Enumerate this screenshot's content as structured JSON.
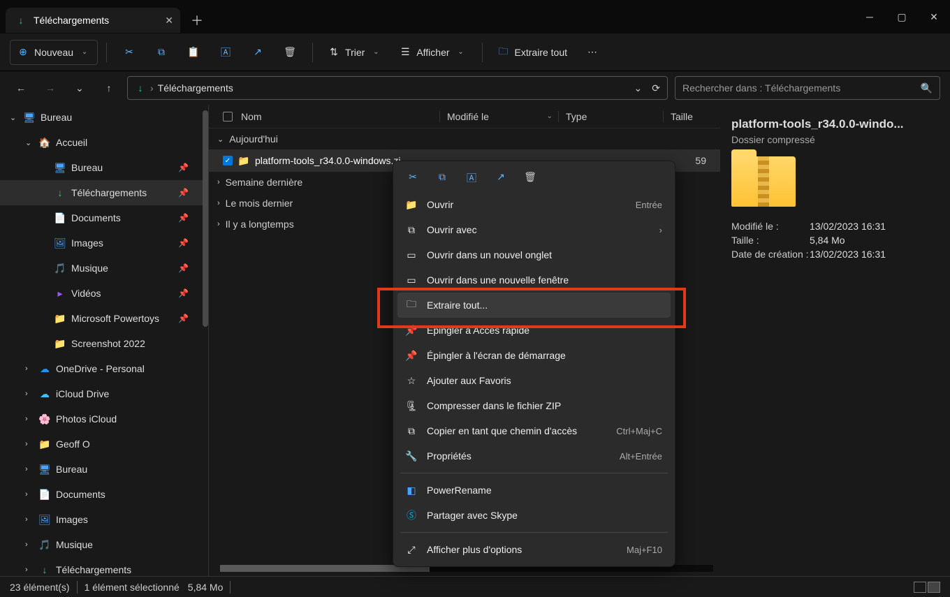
{
  "tab_title": "Téléchargements",
  "toolbar": {
    "new": "Nouveau",
    "sort": "Trier",
    "view": "Afficher",
    "extract": "Extraire tout"
  },
  "breadcrumb": "Téléchargements",
  "search": {
    "placeholder": "Rechercher dans : Téléchargements"
  },
  "sidebar": {
    "items": [
      {
        "label": "Bureau",
        "indent": 0,
        "chev": "⌄",
        "icon": "🖥",
        "color": "#4aa3ff"
      },
      {
        "label": "Accueil",
        "indent": 1,
        "chev": "⌄",
        "icon": "🏠",
        "color": "#ff9a3c"
      },
      {
        "label": "Bureau",
        "indent": 2,
        "icon": "🖥",
        "color": "#4aa3ff",
        "pin": true
      },
      {
        "label": "Téléchargements",
        "indent": 2,
        "icon": "↓",
        "color": "#39c26d",
        "pin": true,
        "sel": true
      },
      {
        "label": "Documents",
        "indent": 2,
        "icon": "📄",
        "color": "#8aa8c9",
        "pin": true
      },
      {
        "label": "Images",
        "indent": 2,
        "icon": "🖼",
        "color": "#4aa3ff",
        "pin": true
      },
      {
        "label": "Musique",
        "indent": 2,
        "icon": "🎵",
        "color": "#ff5e7a",
        "pin": true
      },
      {
        "label": "Vidéos",
        "indent": 2,
        "icon": "▸",
        "color": "#9b59ff",
        "pin": true
      },
      {
        "label": "Microsoft Powertoys",
        "indent": 2,
        "icon": "📁",
        "color": "#ffcf4a",
        "pin": true
      },
      {
        "label": "Screenshot 2022",
        "indent": 2,
        "icon": "📁",
        "color": "#ffcf4a"
      },
      {
        "label": "OneDrive - Personal",
        "indent": 1,
        "chev": "›",
        "icon": "☁",
        "color": "#2a8fe6"
      },
      {
        "label": "iCloud Drive",
        "indent": 1,
        "chev": "›",
        "icon": "☁",
        "color": "#3fc1ff"
      },
      {
        "label": "Photos iCloud",
        "indent": 1,
        "chev": "›",
        "icon": "🌸",
        "color": "#ff7ab3"
      },
      {
        "label": "Geoff O",
        "indent": 1,
        "chev": "›",
        "icon": "📁",
        "color": "#ffcf4a"
      },
      {
        "label": "Bureau",
        "indent": 1,
        "chev": "›",
        "icon": "🖥",
        "color": "#4aa3ff"
      },
      {
        "label": "Documents",
        "indent": 1,
        "chev": "›",
        "icon": "📄",
        "color": "#8aa8c9"
      },
      {
        "label": "Images",
        "indent": 1,
        "chev": "›",
        "icon": "🖼",
        "color": "#4aa3ff"
      },
      {
        "label": "Musique",
        "indent": 1,
        "chev": "›",
        "icon": "🎵",
        "color": "#ff5e7a"
      },
      {
        "label": "Téléchargements",
        "indent": 1,
        "chev": "›",
        "icon": "↓",
        "color": "#39c26d"
      }
    ]
  },
  "columns": {
    "name": "Nom",
    "modified": "Modifié le",
    "type": "Type",
    "size": "Taille"
  },
  "groups": [
    "Aujourd'hui",
    "Semaine dernière",
    "Le mois dernier",
    "Il y a longtemps"
  ],
  "file": {
    "name": "platform-tools_r34.0.0-windows.zi…",
    "size_col": "59"
  },
  "ctx": {
    "open": "Ouvrir",
    "open_sc": "Entrée",
    "openwith": "Ouvrir avec",
    "newtab": "Ouvrir dans un nouvel onglet",
    "newwin": "Ouvrir dans une nouvelle fenêtre",
    "extract": "Extraire tout...",
    "pinquick": "Épingler à Accès rapide",
    "pinstart": "Épingler à l'écran de démarrage",
    "fav": "Ajouter aux Favoris",
    "zip": "Compresser dans le fichier ZIP",
    "copypath": "Copier en tant que chemin d'accès",
    "copypath_sc": "Ctrl+Maj+C",
    "props": "Propriétés",
    "props_sc": "Alt+Entrée",
    "powerrename": "PowerRename",
    "skype": "Partager avec Skype",
    "more": "Afficher plus d'options",
    "more_sc": "Maj+F10"
  },
  "details": {
    "title": "platform-tools_r34.0.0-windo...",
    "subtitle": "Dossier compressé",
    "modified_k": "Modifié le :",
    "modified_v": "13/02/2023 16:31",
    "size_k": "Taille :",
    "size_v": "5,84 Mo",
    "created_k": "Date de création :",
    "created_v": "13/02/2023 16:31"
  },
  "status": {
    "count": "23 élément(s)",
    "sel": "1 élément sélectionné",
    "size": "5,84 Mo"
  }
}
